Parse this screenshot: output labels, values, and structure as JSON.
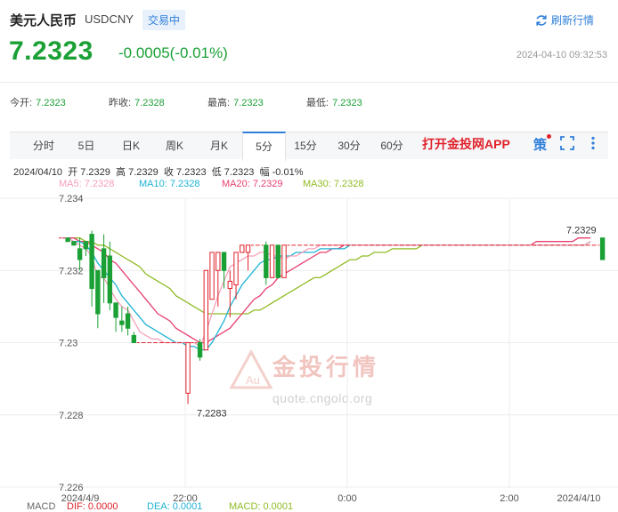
{
  "header": {
    "title": "美元人民币",
    "code": "USDCNY",
    "status_badge": "交易中",
    "refresh_label": "刷新行情",
    "price": "7.2323",
    "change": "-0.0005(-0.01%)",
    "datetime": "2024-04-10 09:32:53"
  },
  "stats": [
    {
      "label": "今开:",
      "value": "7.2323"
    },
    {
      "label": "昨收:",
      "value": "7.2328"
    },
    {
      "label": "最高:",
      "value": "7.2323"
    },
    {
      "label": "最低:",
      "value": "7.2323"
    }
  ],
  "tabs": [
    "分时",
    "5日",
    "日K",
    "周K",
    "月K",
    "5分",
    "15分",
    "30分",
    "60分"
  ],
  "active_tab": "5分",
  "app_link": "打开金投网APP",
  "ce_label": "策",
  "ohlc": {
    "date": "2024/04/10",
    "open_label": "开",
    "open": "7.2329",
    "high_label": "高",
    "high": "7.2329",
    "close_label": "收",
    "close": "7.2323",
    "low_label": "低",
    "low": "7.2323",
    "amp_label": "幅",
    "amp": "-0.01%"
  },
  "ma_legend": [
    {
      "label": "MA5: 7.2328",
      "color": "#f5a0b9"
    },
    {
      "label": "MA10: 7.2328",
      "color": "#1eb3d4"
    },
    {
      "label": "MA20: 7.2329",
      "color": "#e83f6f"
    },
    {
      "label": "MA30: 7.2328",
      "color": "#8fbb23"
    }
  ],
  "watermark": {
    "brand": "金投行情",
    "url": "quote.cngold.org"
  },
  "macd_partial": [
    "MACD",
    "DIF: 0.0000",
    "DEA: 0.0001",
    "MACD: 0.0001"
  ],
  "colors": {
    "up": "#e0212a",
    "down": "#1aa035",
    "accent": "#2f7fd8"
  },
  "chart_data": {
    "type": "candlestick",
    "y_ticks": [
      "7.234",
      "7.232",
      "7.23",
      "7.228",
      "7.226"
    ],
    "ylim": [
      7.226,
      7.234
    ],
    "x_ticks": [
      "2024/4/9",
      "22:00",
      "0:00",
      "2:00",
      "2024/4/10"
    ],
    "annotations": {
      "high": "7.2329",
      "low": "7.2283"
    },
    "candles": [
      {
        "o": 7.2329,
        "h": 7.2329,
        "l": 7.2329,
        "c": 7.2329
      },
      {
        "o": 7.2329,
        "h": 7.2329,
        "l": 7.2329,
        "c": 7.2328
      },
      {
        "o": 7.2328,
        "h": 7.2328,
        "l": 7.2327,
        "c": 7.2327
      },
      {
        "o": 7.2326,
        "h": 7.2329,
        "l": 7.232,
        "c": 7.2323
      },
      {
        "o": 7.2328,
        "h": 7.2328,
        "l": 7.2324,
        "c": 7.2326
      },
      {
        "o": 7.233,
        "h": 7.2331,
        "l": 7.231,
        "c": 7.2315
      },
      {
        "o": 7.232,
        "h": 7.232,
        "l": 7.2304,
        "c": 7.2308
      },
      {
        "o": 7.2326,
        "h": 7.233,
        "l": 7.2311,
        "c": 7.2318
      },
      {
        "o": 7.2324,
        "h": 7.2328,
        "l": 7.2309,
        "c": 7.2311
      },
      {
        "o": 7.2311,
        "h": 7.2311,
        "l": 7.2303,
        "c": 7.2307
      },
      {
        "o": 7.2306,
        "h": 7.231,
        "l": 7.2303,
        "c": 7.2305
      },
      {
        "o": 7.2308,
        "h": 7.231,
        "l": 7.2302,
        "c": 7.2304
      },
      {
        "o": 7.2302,
        "h": 7.2303,
        "l": 7.23,
        "c": 7.23
      },
      {
        "o": 7.23,
        "h": 7.23,
        "l": 7.23,
        "c": 7.23
      },
      {
        "o": 7.23,
        "h": 7.23,
        "l": 7.23,
        "c": 7.23
      },
      {
        "o": 7.23,
        "h": 7.23,
        "l": 7.23,
        "c": 7.23
      },
      {
        "o": 7.23,
        "h": 7.23,
        "l": 7.23,
        "c": 7.23
      },
      {
        "o": 7.23,
        "h": 7.23,
        "l": 7.23,
        "c": 7.23
      },
      {
        "o": 7.23,
        "h": 7.23,
        "l": 7.23,
        "c": 7.23
      },
      {
        "o": 7.23,
        "h": 7.23,
        "l": 7.23,
        "c": 7.23
      },
      {
        "o": 7.23,
        "h": 7.23,
        "l": 7.23,
        "c": 7.23
      },
      {
        "o": 7.2286,
        "h": 7.23,
        "l": 7.2283,
        "c": 7.23
      },
      {
        "o": 7.23,
        "h": 7.23,
        "l": 7.23,
        "c": 7.23
      },
      {
        "o": 7.23,
        "h": 7.2301,
        "l": 7.2295,
        "c": 7.2296
      },
      {
        "o": 7.2298,
        "h": 7.232,
        "l": 7.2298,
        "c": 7.232
      },
      {
        "o": 7.2312,
        "h": 7.2325,
        "l": 7.2312,
        "c": 7.2325
      },
      {
        "o": 7.232,
        "h": 7.2325,
        "l": 7.231,
        "c": 7.2325
      },
      {
        "o": 7.2325,
        "h": 7.2325,
        "l": 7.2315,
        "c": 7.232
      },
      {
        "o": 7.2315,
        "h": 7.232,
        "l": 7.2307,
        "c": 7.2317
      },
      {
        "o": 7.2316,
        "h": 7.2325,
        "l": 7.2312,
        "c": 7.2325
      },
      {
        "o": 7.2325,
        "h": 7.2327,
        "l": 7.2325,
        "c": 7.2327
      },
      {
        "o": 7.2325,
        "h": 7.2327,
        "l": 7.232,
        "c": 7.2327
      },
      {
        "o": 7.2327,
        "h": 7.2327,
        "l": 7.2327,
        "c": 7.2327
      },
      {
        "o": 7.2327,
        "h": 7.2327,
        "l": 7.2327,
        "c": 7.2327
      },
      {
        "o": 7.2327,
        "h": 7.2328,
        "l": 7.2316,
        "c": 7.2318
      },
      {
        "o": 7.2318,
        "h": 7.2327,
        "l": 7.2318,
        "c": 7.2327
      },
      {
        "o": 7.2327,
        "h": 7.2327,
        "l": 7.2318,
        "c": 7.2318
      },
      {
        "o": 7.2318,
        "h": 7.2318,
        "l": 7.2318,
        "c": 7.2327
      },
      {
        "o": 7.2327,
        "h": 7.2327,
        "l": 7.2327,
        "c": 7.2327
      },
      {
        "o": 7.2327,
        "h": 7.2327,
        "l": 7.2327,
        "c": 7.2327
      },
      {
        "o": 7.2327,
        "h": 7.2327,
        "l": 7.2327,
        "c": 7.2327
      },
      {
        "o": 7.2327,
        "h": 7.2327,
        "l": 7.2327,
        "c": 7.2327
      },
      {
        "o": 7.2327,
        "h": 7.2327,
        "l": 7.2327,
        "c": 7.2327
      },
      {
        "o": 7.2327,
        "h": 7.2327,
        "l": 7.2327,
        "c": 7.2327
      },
      {
        "o": 7.2327,
        "h": 7.2327,
        "l": 7.2327,
        "c": 7.2327
      },
      {
        "o": 7.2327,
        "h": 7.2327,
        "l": 7.2327,
        "c": 7.2327
      },
      {
        "o": 7.2327,
        "h": 7.2327,
        "l": 7.2327,
        "c": 7.2327
      },
      {
        "o": 7.2327,
        "h": 7.2327,
        "l": 7.2327,
        "c": 7.2327
      },
      {
        "o": 7.2327,
        "h": 7.2327,
        "l": 7.2327,
        "c": 7.2327
      },
      {
        "o": 7.2327,
        "h": 7.2327,
        "l": 7.2327,
        "c": 7.2327
      },
      {
        "o": 7.2327,
        "h": 7.2327,
        "l": 7.2327,
        "c": 7.2327
      },
      {
        "o": 7.2327,
        "h": 7.2327,
        "l": 7.2327,
        "c": 7.2327
      },
      {
        "o": 7.2327,
        "h": 7.2327,
        "l": 7.2327,
        "c": 7.2327
      },
      {
        "o": 7.2327,
        "h": 7.2327,
        "l": 7.2327,
        "c": 7.2327
      },
      {
        "o": 7.2327,
        "h": 7.2327,
        "l": 7.2327,
        "c": 7.2327
      },
      {
        "o": 7.2327,
        "h": 7.2327,
        "l": 7.2327,
        "c": 7.2327
      },
      {
        "o": 7.2327,
        "h": 7.2327,
        "l": 7.2327,
        "c": 7.2327
      },
      {
        "o": 7.2327,
        "h": 7.2327,
        "l": 7.2327,
        "c": 7.2327
      },
      {
        "o": 7.2327,
        "h": 7.2327,
        "l": 7.2327,
        "c": 7.2327
      },
      {
        "o": 7.2327,
        "h": 7.2327,
        "l": 7.2327,
        "c": 7.2327
      },
      {
        "o": 7.2327,
        "h": 7.2327,
        "l": 7.2327,
        "c": 7.2327
      },
      {
        "o": 7.2327,
        "h": 7.2327,
        "l": 7.2327,
        "c": 7.2327
      },
      {
        "o": 7.2327,
        "h": 7.2327,
        "l": 7.2327,
        "c": 7.2327
      },
      {
        "o": 7.2327,
        "h": 7.2327,
        "l": 7.2327,
        "c": 7.2327
      },
      {
        "o": 7.2327,
        "h": 7.2327,
        "l": 7.2327,
        "c": 7.2327
      },
      {
        "o": 7.2327,
        "h": 7.2327,
        "l": 7.2327,
        "c": 7.2327
      },
      {
        "o": 7.2327,
        "h": 7.2327,
        "l": 7.2327,
        "c": 7.2327
      },
      {
        "o": 7.2327,
        "h": 7.2327,
        "l": 7.2327,
        "c": 7.2327
      },
      {
        "o": 7.2327,
        "h": 7.2327,
        "l": 7.2327,
        "c": 7.2327
      },
      {
        "o": 7.2327,
        "h": 7.2327,
        "l": 7.2327,
        "c": 7.2327
      },
      {
        "o": 7.2327,
        "h": 7.2327,
        "l": 7.2327,
        "c": 7.2327
      },
      {
        "o": 7.2327,
        "h": 7.2327,
        "l": 7.2327,
        "c": 7.2327
      },
      {
        "o": 7.2327,
        "h": 7.2327,
        "l": 7.2327,
        "c": 7.2327
      },
      {
        "o": 7.2327,
        "h": 7.2327,
        "l": 7.2327,
        "c": 7.2327
      },
      {
        "o": 7.2327,
        "h": 7.2327,
        "l": 7.2327,
        "c": 7.2327
      },
      {
        "o": 7.2327,
        "h": 7.2327,
        "l": 7.2327,
        "c": 7.2327
      },
      {
        "o": 7.2327,
        "h": 7.2327,
        "l": 7.2327,
        "c": 7.2327
      },
      {
        "o": 7.2327,
        "h": 7.2327,
        "l": 7.2327,
        "c": 7.2327
      },
      {
        "o": 7.2327,
        "h": 7.2327,
        "l": 7.2327,
        "c": 7.2327
      },
      {
        "o": 7.2327,
        "h": 7.2327,
        "l": 7.2327,
        "c": 7.2327
      },
      {
        "o": 7.2327,
        "h": 7.2327,
        "l": 7.2327,
        "c": 7.2327
      },
      {
        "o": 7.2327,
        "h": 7.2327,
        "l": 7.2327,
        "c": 7.2327
      },
      {
        "o": 7.2327,
        "h": 7.2327,
        "l": 7.2327,
        "c": 7.2327
      },
      {
        "o": 7.2327,
        "h": 7.2327,
        "l": 7.2327,
        "c": 7.2327
      },
      {
        "o": 7.2327,
        "h": 7.2327,
        "l": 7.2327,
        "c": 7.2327
      },
      {
        "o": 7.2327,
        "h": 7.2327,
        "l": 7.2327,
        "c": 7.2327
      },
      {
        "o": 7.2327,
        "h": 7.2327,
        "l": 7.2327,
        "c": 7.2327
      },
      {
        "o": 7.2327,
        "h": 7.2327,
        "l": 7.2327,
        "c": 7.2327
      },
      {
        "o": 7.2327,
        "h": 7.2327,
        "l": 7.2327,
        "c": 7.2327
      },
      {
        "o": 7.2327,
        "h": 7.2327,
        "l": 7.2327,
        "c": 7.2327
      },
      {
        "o": 7.2329,
        "h": 7.2329,
        "l": 7.2323,
        "c": 7.2323
      }
    ],
    "ma5": [
      7.2329,
      7.2329,
      7.2328,
      7.2327,
      7.2326,
      7.2324,
      7.2318,
      7.2318,
      7.2315,
      7.2312,
      7.231,
      7.2309,
      7.2306,
      7.2303,
      7.2302,
      7.2301,
      7.2301,
      7.23,
      7.23,
      7.23,
      7.23,
      7.23,
      7.23,
      7.2299,
      7.2303,
      7.2308,
      7.2313,
      7.2317,
      7.2321,
      7.2322,
      7.2323,
      7.2324,
      7.2324,
      7.2325,
      7.2325,
      7.2324,
      7.2324,
      7.2323,
      7.2324,
      7.2324,
      7.2325,
      7.2326,
      7.2326,
      7.2327,
      7.2327,
      7.2327,
      7.2327,
      7.2327,
      7.2327,
      7.2327,
      7.2327,
      7.2327,
      7.2327,
      7.2327,
      7.2327,
      7.2327,
      7.2327,
      7.2327,
      7.2327,
      7.2327,
      7.2327,
      7.2327,
      7.2327,
      7.2327,
      7.2327,
      7.2327,
      7.2327,
      7.2327,
      7.2327,
      7.2327,
      7.2327,
      7.2327,
      7.2327,
      7.2327,
      7.2327,
      7.2327,
      7.2327,
      7.2327,
      7.2327,
      7.2327,
      7.2327,
      7.2327,
      7.2327,
      7.2327,
      7.2327,
      7.2327,
      7.2327,
      7.2327,
      7.2328
    ],
    "ma10": [
      7.2329,
      7.2329,
      7.2328,
      7.2328,
      7.2327,
      7.2325,
      7.2322,
      7.232,
      7.2318,
      7.2316,
      7.2313,
      7.2311,
      7.2309,
      7.2307,
      7.2305,
      7.2304,
      7.2303,
      7.2302,
      7.2301,
      7.23,
      7.23,
      7.2299,
      7.2299,
      7.2298,
      7.2298,
      7.23,
      7.2303,
      7.2306,
      7.231,
      7.2313,
      7.2316,
      7.2318,
      7.232,
      7.2322,
      7.2323,
      7.2323,
      7.2324,
      7.2324,
      7.2324,
      7.2325,
      7.2325,
      7.2325,
      7.2325,
      7.2326,
      7.2326,
      7.2326,
      7.2326,
      7.2326,
      7.2327,
      7.2327,
      7.2327,
      7.2327,
      7.2327,
      7.2327,
      7.2327,
      7.2327,
      7.2327,
      7.2327,
      7.2327,
      7.2327,
      7.2327,
      7.2327,
      7.2327,
      7.2327,
      7.2327,
      7.2327,
      7.2327,
      7.2327,
      7.2327,
      7.2327,
      7.2327,
      7.2327,
      7.2327,
      7.2327,
      7.2327,
      7.2327,
      7.2327,
      7.2327,
      7.2327,
      7.2327,
      7.2327,
      7.2327,
      7.2327,
      7.2327,
      7.2327,
      7.2327,
      7.2327,
      7.2327,
      7.2328
    ],
    "ma20": [
      7.2329,
      7.2329,
      7.2329,
      7.2328,
      7.2328,
      7.2327,
      7.2326,
      7.2325,
      7.2323,
      7.2322,
      7.232,
      7.2318,
      7.2316,
      7.2314,
      7.2312,
      7.231,
      7.2308,
      7.2307,
      7.2306,
      7.2304,
      7.2303,
      7.2302,
      7.2301,
      7.23,
      7.23,
      7.2301,
      7.2302,
      7.2303,
      7.2304,
      7.2306,
      7.2308,
      7.231,
      7.2312,
      7.2313,
      7.2315,
      7.2316,
      7.2318,
      7.2319,
      7.232,
      7.2321,
      7.2322,
      7.2323,
      7.2324,
      7.2325,
      7.2325,
      7.2326,
      7.2326,
      7.2327,
      7.2327,
      7.2327,
      7.2327,
      7.2327,
      7.2327,
      7.2327,
      7.2327,
      7.2327,
      7.2327,
      7.2327,
      7.2327,
      7.2327,
      7.2327,
      7.2327,
      7.2327,
      7.2327,
      7.2327,
      7.2327,
      7.2327,
      7.2327,
      7.2327,
      7.2327,
      7.2327,
      7.2327,
      7.2327,
      7.2327,
      7.2327,
      7.2327,
      7.2327,
      7.2327,
      7.2327,
      7.2328,
      7.2328,
      7.2328,
      7.2328,
      7.2328,
      7.2328,
      7.2328,
      7.2329,
      7.2329,
      7.2329
    ],
    "ma30": [
      7.2329,
      7.2329,
      7.2329,
      7.2329,
      7.2328,
      7.2328,
      7.2327,
      7.2327,
      7.2326,
      7.2325,
      7.2324,
      7.2323,
      7.2322,
      7.2321,
      7.2319,
      7.2318,
      7.2317,
      7.2316,
      7.2315,
      7.2313,
      7.2312,
      7.2311,
      7.231,
      7.2309,
      7.2308,
      7.2308,
      7.2308,
      7.2308,
      7.2308,
      7.2308,
      7.2308,
      7.2308,
      7.2309,
      7.2309,
      7.231,
      7.2311,
      7.2312,
      7.2313,
      7.2314,
      7.2315,
      7.2316,
      7.2317,
      7.2318,
      7.2318,
      7.2319,
      7.232,
      7.2321,
      7.2322,
      7.2323,
      7.2323,
      7.2324,
      7.2324,
      7.2325,
      7.2325,
      7.2325,
      7.2326,
      7.2326,
      7.2326,
      7.2326,
      7.2326,
      7.2327,
      7.2327,
      7.2327,
      7.2327,
      7.2327,
      7.2327,
      7.2327,
      7.2327,
      7.2327,
      7.2327,
      7.2327,
      7.2327,
      7.2327,
      7.2327,
      7.2327,
      7.2327,
      7.2327,
      7.2327,
      7.2327,
      7.2327,
      7.2327,
      7.2327,
      7.2327,
      7.2327,
      7.2327,
      7.2327,
      7.2327,
      7.2327,
      7.2328
    ]
  }
}
